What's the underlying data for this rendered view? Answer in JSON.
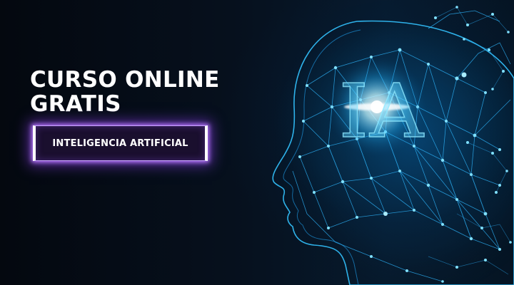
{
  "headline": {
    "line1": "CURSO ONLINE",
    "line2": "GRATIS"
  },
  "badge": {
    "label": "INTELIGENCIA ARTIFICIAL"
  },
  "illustration": {
    "overlay_text": "IA",
    "colors": {
      "background": "#050b16",
      "network_line": "#2fb8ff",
      "network_node": "#7fe0ff",
      "glow": "#e8fbff",
      "badge_glow": "#b57cff"
    }
  }
}
